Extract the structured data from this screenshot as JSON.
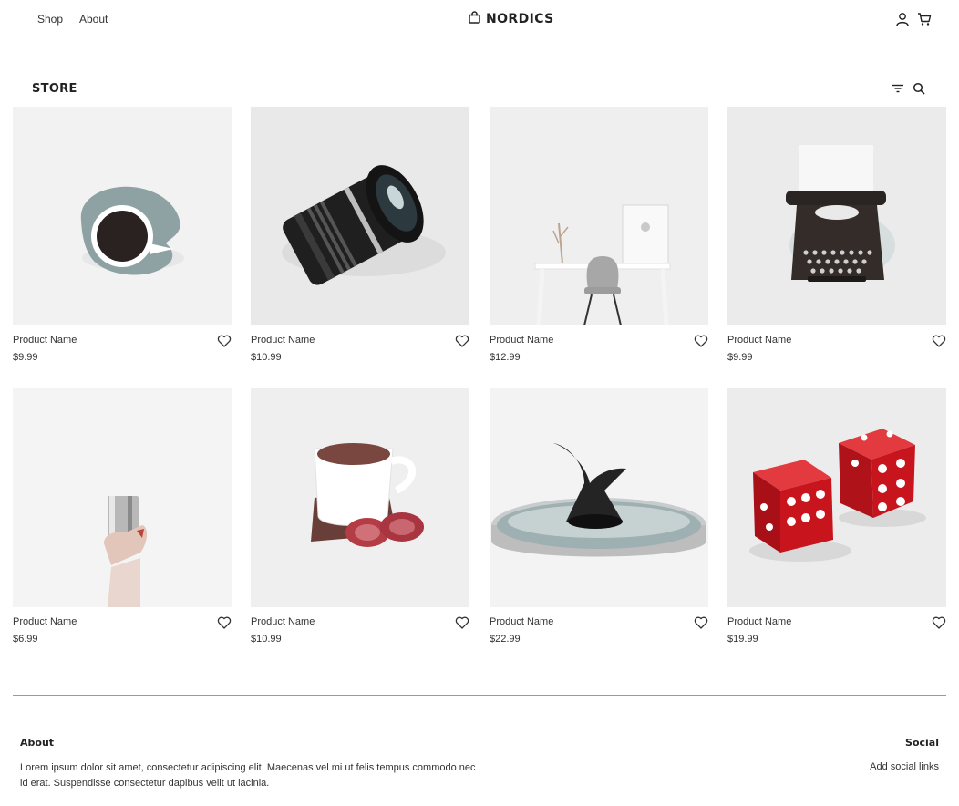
{
  "header": {
    "nav": [
      {
        "label": "Shop"
      },
      {
        "label": "About"
      }
    ],
    "brand": "NORDICS",
    "icons": [
      "shopping-bag-icon",
      "user-icon",
      "cart-icon"
    ]
  },
  "store": {
    "title": "STORE",
    "tools": [
      "filter-icon",
      "search-icon"
    ]
  },
  "products": [
    {
      "name": "Product Name",
      "price": "$9.99",
      "image": "coffee-cup-top-view"
    },
    {
      "name": "Product Name",
      "price": "$10.99",
      "image": "camera-lens"
    },
    {
      "name": "Product Name",
      "price": "$12.99",
      "image": "desk-and-chair"
    },
    {
      "name": "Product Name",
      "price": "$9.99",
      "image": "typewriter"
    },
    {
      "name": "Product Name",
      "price": "$6.99",
      "image": "hand-holding-steel-cup"
    },
    {
      "name": "Product Name",
      "price": "$10.99",
      "image": "tea-cup-with-cookies"
    },
    {
      "name": "Product Name",
      "price": "$22.99",
      "image": "sculpture-on-tray"
    },
    {
      "name": "Product Name",
      "price": "$19.99",
      "image": "red-dice"
    }
  ],
  "footer": {
    "about_heading": "About",
    "about_text": "Lorem ipsum dolor sit amet, consectetur adipiscing elit. Maecenas vel mi ut felis tempus commodo nec id erat. Suspendisse consectetur dapibus velit ut lacinia.",
    "social_heading": "Social",
    "social_link": "Add social links"
  },
  "colors": {
    "text": "#222222",
    "background": "#ffffff",
    "divider": "#9a9a9a",
    "dice_red": "#c8141c"
  }
}
